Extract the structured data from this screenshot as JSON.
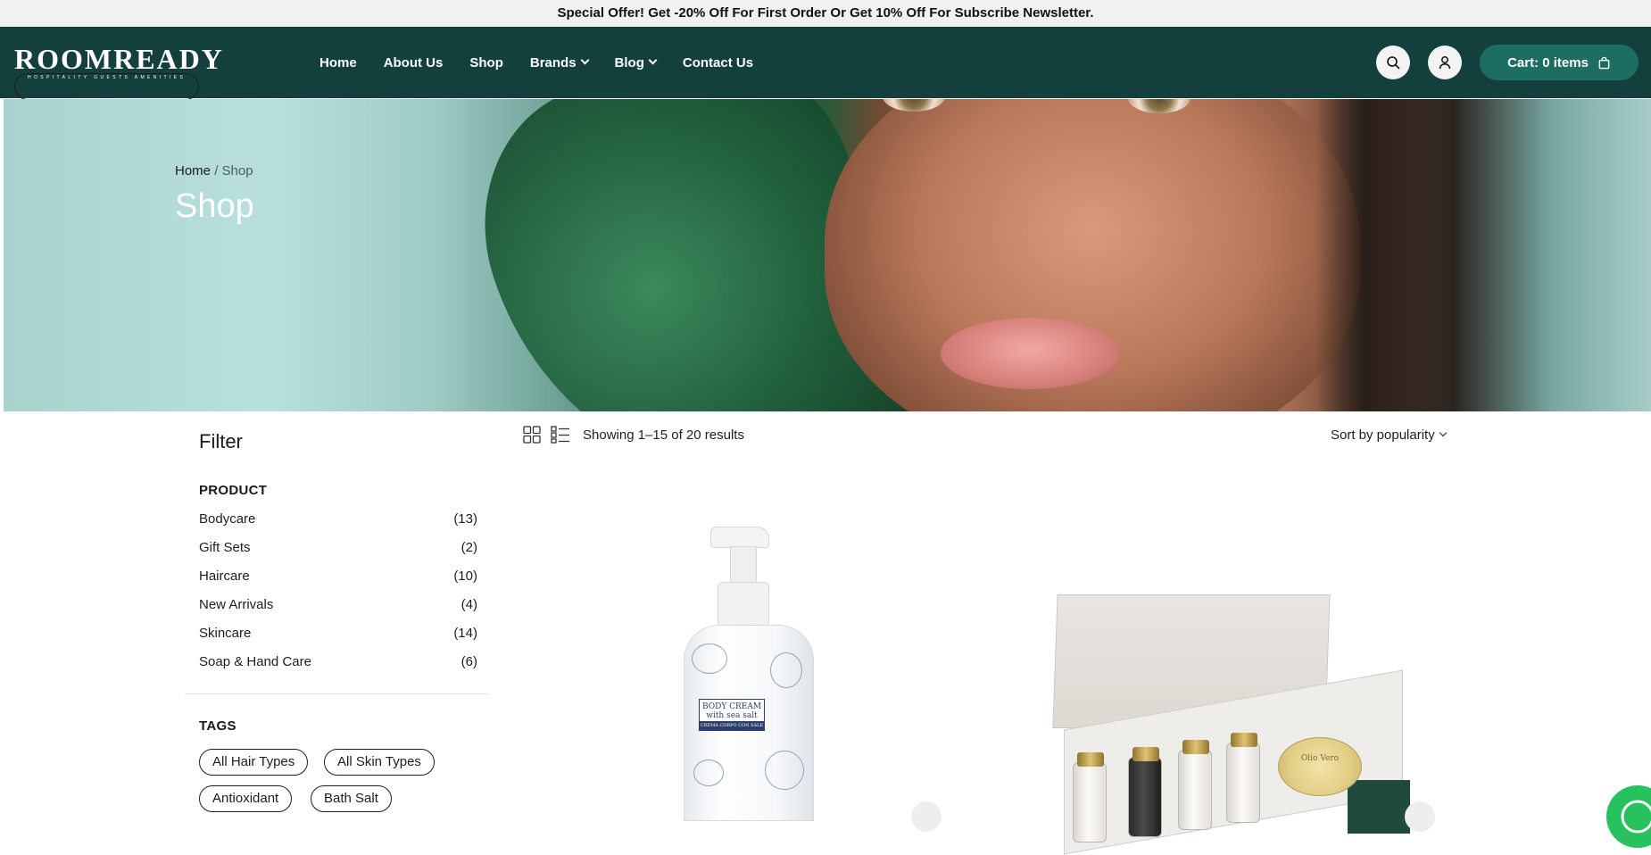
{
  "announcement": "Special Offer! Get -20% Off For First Order Or Get 10% Off For Subscribe Newsletter.",
  "logo": {
    "word": "ROOMREADY",
    "tagline": "HOSPITALITY GUESTS AMENITIES"
  },
  "nav": {
    "home": "Home",
    "about": "About Us",
    "shop": "Shop",
    "brands": "Brands",
    "blog": "Blog",
    "contact": "Contact Us"
  },
  "cart": {
    "label": "Cart: 0 items"
  },
  "hero": {
    "breadcrumb_home": "Home",
    "breadcrumb_sep": "/",
    "breadcrumb_current": "Shop",
    "title": "Shop"
  },
  "filter": {
    "title": "Filter",
    "product_heading": "PRODUCT",
    "categories": [
      {
        "name": "Bodycare",
        "count": "(13)"
      },
      {
        "name": "Gift Sets",
        "count": "(2)"
      },
      {
        "name": "Haircare",
        "count": "(10)"
      },
      {
        "name": "New Arrivals",
        "count": "(4)"
      },
      {
        "name": "Skincare",
        "count": "(14)"
      },
      {
        "name": "Soap & Hand Care",
        "count": "(6)"
      }
    ],
    "tags_heading": "TAGS",
    "tags": [
      "All Hair Types",
      "All Skin Types",
      "Antioxidant",
      "Bath Salt"
    ]
  },
  "toolbar": {
    "showing": "Showing 1–15 of 20 results",
    "sort": "Sort by popularity"
  },
  "products": [
    {
      "label_title": "BODY CREAM",
      "label_sub": "with sea salt",
      "label_strip": "CREMA CORPO CON SALE MARINO"
    },
    {
      "soap_text": "Olio Vero"
    }
  ],
  "colors": {
    "header_bg": "#133f3c",
    "cart_bg": "#1e6d63",
    "announcement_bg": "#f1f1f1"
  }
}
